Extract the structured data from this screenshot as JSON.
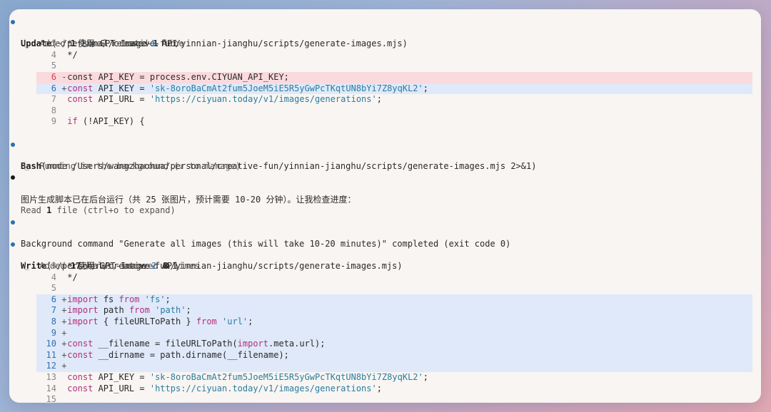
{
  "blocks": {
    "update": {
      "tool": "Update",
      "args": "(~/personal/creative-fun/yinnian-jianghu/scripts/generate-images.mjs)",
      "summary": {
        "pre": "Added ",
        "n1": "1",
        "mid": " line, removed ",
        "n2": "1",
        "post": " line"
      },
      "lines": [
        {
          "num": "3",
          "mk": " ",
          "type": "ctx",
          "tokens": [
            [
              "",
              "* 使用 GPT-Image-"
            ],
            [
              "nm",
              "2"
            ],
            [
              "",
              " API"
            ]
          ]
        },
        {
          "num": "4",
          "mk": " ",
          "type": "ctx",
          "tokens": [
            [
              "",
              "*/"
            ]
          ]
        },
        {
          "num": "5",
          "mk": " ",
          "type": "ctx",
          "tokens": []
        },
        {
          "num": "6",
          "mk": "-",
          "type": "del",
          "tokens": [
            [
              "",
              "const API_KEY = process.env.CIYUAN_API_KEY;"
            ]
          ]
        },
        {
          "num": "6",
          "mk": "+",
          "type": "add",
          "tokens": [
            [
              "kw",
              "const"
            ],
            [
              "",
              " API_KEY = "
            ],
            [
              "str",
              "'sk-8oroBaCmAt2fum5JoeM5iE5R5yGwPcTKqtUN8bYi7Z8yqKL2'"
            ],
            [
              "",
              ";"
            ]
          ]
        },
        {
          "num": "7",
          "mk": " ",
          "type": "ctx",
          "tokens": [
            [
              "kw",
              "const"
            ],
            [
              "",
              " API_URL = "
            ],
            [
              "str",
              "'https://ciyuan.today/v1/images/generations'"
            ],
            [
              "",
              ";"
            ]
          ]
        },
        {
          "num": "8",
          "mk": " ",
          "type": "ctx",
          "tokens": []
        },
        {
          "num": "9",
          "mk": " ",
          "type": "ctx",
          "tokens": [
            [
              "kw",
              "if"
            ],
            [
              "",
              " (!API_KEY) {"
            ]
          ]
        }
      ]
    },
    "bash": {
      "tool": "Bash",
      "args": "(node /Users/wangzhaohua/personal/creative-fun/yinnian-jianghu/scripts/generate-images.mjs 2>&1)",
      "sub": "Running in the background (↓ to manage)"
    },
    "message": "图片生成脚本已在后台运行（共 25 张图片，预计需要 10-20 分钟）。让我检查进度：",
    "read": {
      "pre": "Read ",
      "n": "1",
      "post": " file (ctrl+o to expand)"
    },
    "background": "Background command \"Generate all images (this will take 10-20 minutes)\" completed (exit code 0)",
    "write": {
      "tool": "Write",
      "args": "(~/personal/creative-fun/yinnian-jianghu/scripts/generate-images.mjs)",
      "summary": {
        "pre": "Added ",
        "n1": "17",
        "mid": " lines, removed ",
        "n2": "8",
        "post": " lines"
      },
      "lines": [
        {
          "num": "3",
          "mk": " ",
          "type": "ctx",
          "tokens": [
            [
              "",
              "* 使用 GPT-Image-"
            ],
            [
              "nm",
              "2"
            ],
            [
              "",
              " API"
            ]
          ]
        },
        {
          "num": "4",
          "mk": " ",
          "type": "ctx",
          "tokens": [
            [
              "",
              "*/"
            ]
          ]
        },
        {
          "num": "5",
          "mk": " ",
          "type": "ctx",
          "tokens": []
        },
        {
          "num": "6",
          "mk": "+",
          "type": "add",
          "tokens": [
            [
              "kw",
              "import"
            ],
            [
              "",
              " fs "
            ],
            [
              "kw",
              "from"
            ],
            [
              "",
              " "
            ],
            [
              "str",
              "'fs'"
            ],
            [
              "",
              ";"
            ]
          ]
        },
        {
          "num": "7",
          "mk": "+",
          "type": "add",
          "tokens": [
            [
              "kw",
              "import"
            ],
            [
              "",
              " path "
            ],
            [
              "kw",
              "from"
            ],
            [
              "",
              " "
            ],
            [
              "str",
              "'path'"
            ],
            [
              "",
              ";"
            ]
          ]
        },
        {
          "num": "8",
          "mk": "+",
          "type": "add",
          "tokens": [
            [
              "kw",
              "import"
            ],
            [
              "",
              " { fileURLToPath } "
            ],
            [
              "kw",
              "from"
            ],
            [
              "",
              " "
            ],
            [
              "str",
              "'url'"
            ],
            [
              "",
              ";"
            ]
          ]
        },
        {
          "num": "9",
          "mk": "+",
          "type": "add",
          "tokens": []
        },
        {
          "num": "10",
          "mk": "+",
          "type": "add",
          "tokens": [
            [
              "kw",
              "const"
            ],
            [
              "",
              " __filename = fileURLToPath("
            ],
            [
              "kw",
              "import"
            ],
            [
              "",
              ".meta.url);"
            ]
          ]
        },
        {
          "num": "11",
          "mk": "+",
          "type": "add",
          "tokens": [
            [
              "kw",
              "const"
            ],
            [
              "",
              " __dirname = path.dirname(__filename);"
            ]
          ]
        },
        {
          "num": "12",
          "mk": "+",
          "type": "add",
          "tokens": []
        },
        {
          "num": "13",
          "mk": " ",
          "type": "ctx",
          "tokens": [
            [
              "kw",
              "const"
            ],
            [
              "",
              " API_KEY = "
            ],
            [
              "str",
              "'sk-8oroBaCmAt2fum5JoeM5iE5R5yGwPcTKqtUN8bYi7Z8yqKL2'"
            ],
            [
              "",
              ";"
            ]
          ]
        },
        {
          "num": "14",
          "mk": " ",
          "type": "ctx",
          "tokens": [
            [
              "kw",
              "const"
            ],
            [
              "",
              " API_URL = "
            ],
            [
              "str",
              "'https://ciyuan.today/v1/images/generations'"
            ],
            [
              "",
              ";"
            ]
          ]
        },
        {
          "num": "15",
          "mk": " ",
          "type": "ctx",
          "tokens": []
        }
      ]
    }
  },
  "colors": {
    "bullet_tool": "#2f6fb0",
    "bullet_msg": "#1a1a1a",
    "del_bg": "#fadadd",
    "add_bg": "#dfe9f9",
    "keyword": "#b0307a",
    "string": "#2a7da0"
  }
}
